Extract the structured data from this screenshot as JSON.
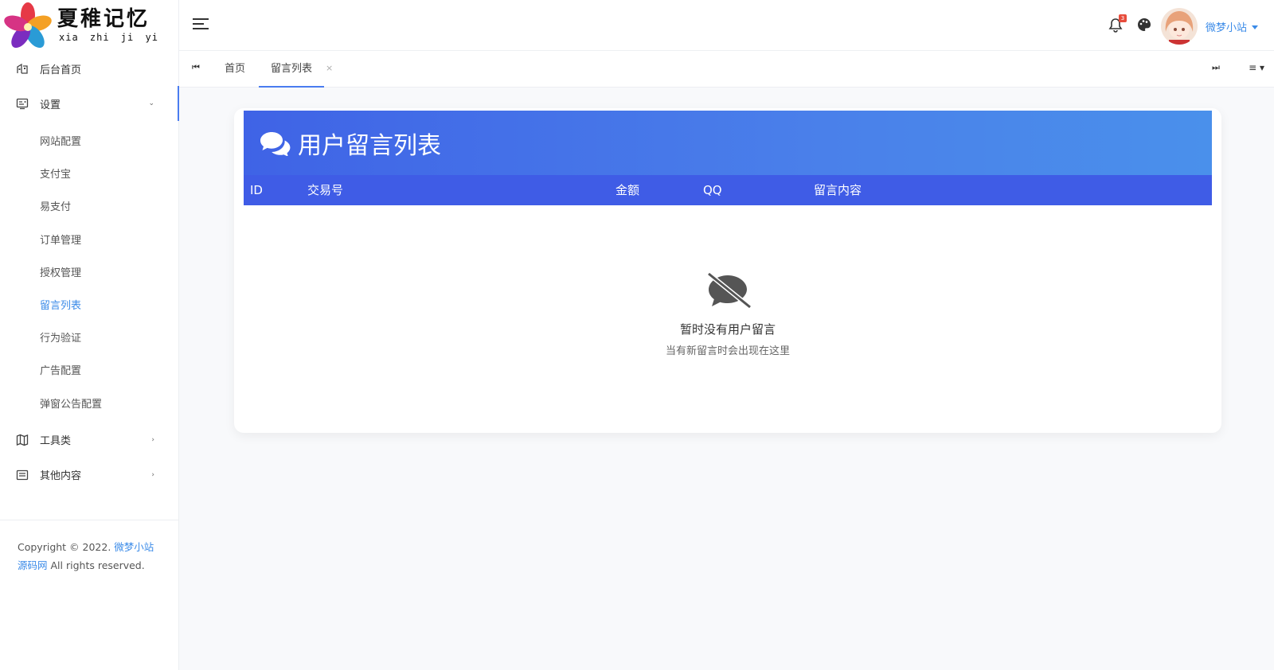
{
  "brand": {
    "main": "夏稚记忆",
    "sub": "xia zhi ji yi"
  },
  "sidebar": {
    "items": [
      {
        "label": "后台首页",
        "icon": "dashboard-icon"
      },
      {
        "label": "设置",
        "icon": "settings-card-icon",
        "open": true
      },
      {
        "label": "工具类",
        "icon": "map-icon"
      },
      {
        "label": "其他内容",
        "icon": "list-icon"
      }
    ],
    "sub_items": [
      "网站配置",
      "支付宝",
      "易支付",
      "订单管理",
      "授权管理",
      "留言列表",
      "行为验证",
      "广告配置",
      "弹窗公告配置"
    ],
    "active_sub": "留言列表"
  },
  "copyright": {
    "prefix": "Copyright © 2022.",
    "link": "微梦小站源码网",
    "suffix": "All rights reserved."
  },
  "topbar": {
    "notification_count": "3",
    "username": "微梦小站"
  },
  "tabs": [
    {
      "label": "首页",
      "active": false
    },
    {
      "label": "留言列表",
      "active": true,
      "close": "×"
    }
  ],
  "card": {
    "title": "用户留言列表",
    "columns": [
      "ID",
      "交易号",
      "金额",
      "QQ",
      "留言内容"
    ],
    "empty_title": "暂时没有用户留言",
    "empty_sub": "当有新留言时会出现在这里"
  },
  "colors": {
    "accent": "#3b8be8",
    "header_from": "#3f63e6",
    "header_to": "#4a90eb",
    "table_head": "#3f5ce6"
  }
}
